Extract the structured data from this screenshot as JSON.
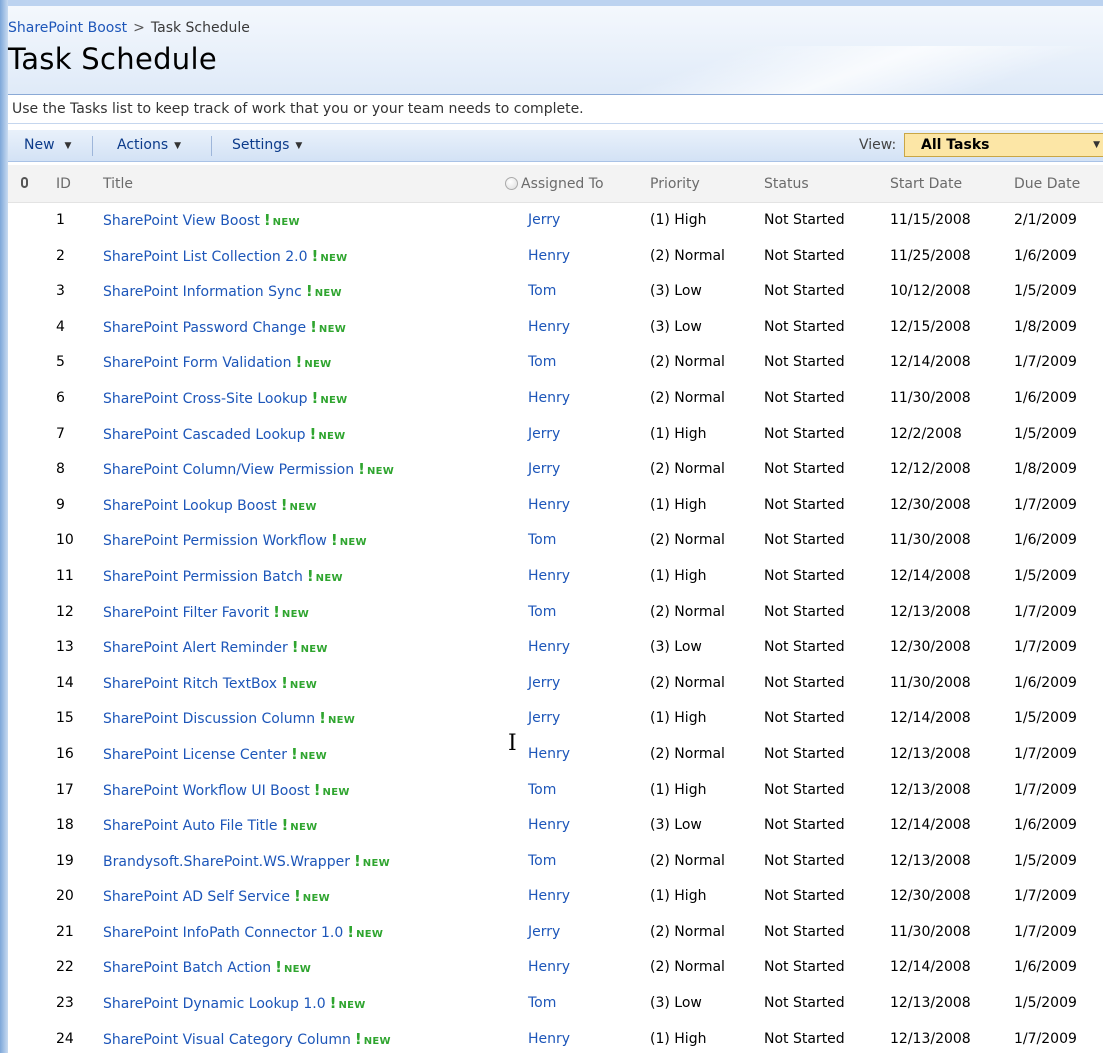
{
  "breadcrumb": {
    "site": "SharePoint Boost",
    "separator": ">",
    "current": "Task Schedule"
  },
  "page_title": "Task Schedule",
  "description": "Use the Tasks list to keep track of work that you or your team needs to complete.",
  "toolbar": {
    "new_label": "New",
    "actions_label": "Actions",
    "settings_label": "Settings",
    "view_label": "View:",
    "view_value": "All Tasks"
  },
  "columns": {
    "id": "ID",
    "title": "Title",
    "assigned_to": "Assigned To",
    "priority": "Priority",
    "status": "Status",
    "start_date": "Start Date",
    "due_date": "Due Date"
  },
  "new_badge": "NEW",
  "new_mark": "!",
  "rows": [
    {
      "id": "1",
      "title": "SharePoint View Boost",
      "assigned": "Jerry",
      "priority": "(1) High",
      "status": "Not Started",
      "start": "11/15/2008",
      "due": "2/1/2009"
    },
    {
      "id": "2",
      "title": "SharePoint List Collection 2.0",
      "assigned": "Henry",
      "priority": "(2) Normal",
      "status": "Not Started",
      "start": "11/25/2008",
      "due": "1/6/2009"
    },
    {
      "id": "3",
      "title": "SharePoint Information Sync",
      "assigned": "Tom",
      "priority": "(3) Low",
      "status": "Not Started",
      "start": "10/12/2008",
      "due": "1/5/2009"
    },
    {
      "id": "4",
      "title": "SharePoint Password Change",
      "assigned": "Henry",
      "priority": "(3) Low",
      "status": "Not Started",
      "start": "12/15/2008",
      "due": "1/8/2009"
    },
    {
      "id": "5",
      "title": "SharePoint Form Validation",
      "assigned": "Tom",
      "priority": "(2) Normal",
      "status": "Not Started",
      "start": "12/14/2008",
      "due": "1/7/2009"
    },
    {
      "id": "6",
      "title": "SharePoint Cross-Site Lookup",
      "assigned": "Henry",
      "priority": "(2) Normal",
      "status": "Not Started",
      "start": "11/30/2008",
      "due": "1/6/2009"
    },
    {
      "id": "7",
      "title": "SharePoint Cascaded Lookup",
      "assigned": "Jerry",
      "priority": "(1) High",
      "status": "Not Started",
      "start": "12/2/2008",
      "due": "1/5/2009"
    },
    {
      "id": "8",
      "title": "SharePoint Column/View Permission",
      "assigned": "Jerry",
      "priority": "(2) Normal",
      "status": "Not Started",
      "start": "12/12/2008",
      "due": "1/8/2009"
    },
    {
      "id": "9",
      "title": "SharePoint Lookup Boost",
      "assigned": "Henry",
      "priority": "(1) High",
      "status": "Not Started",
      "start": "12/30/2008",
      "due": "1/7/2009"
    },
    {
      "id": "10",
      "title": "SharePoint Permission Workflow",
      "assigned": "Tom",
      "priority": "(2) Normal",
      "status": "Not Started",
      "start": "11/30/2008",
      "due": "1/6/2009"
    },
    {
      "id": "11",
      "title": "SharePoint Permission Batch",
      "assigned": "Henry",
      "priority": "(1) High",
      "status": "Not Started",
      "start": "12/14/2008",
      "due": "1/5/2009"
    },
    {
      "id": "12",
      "title": "SharePoint Filter Favorit",
      "assigned": "Tom",
      "priority": "(2) Normal",
      "status": "Not Started",
      "start": "12/13/2008",
      "due": "1/7/2009"
    },
    {
      "id": "13",
      "title": "SharePoint Alert Reminder",
      "assigned": "Henry",
      "priority": "(3) Low",
      "status": "Not Started",
      "start": "12/30/2008",
      "due": "1/7/2009"
    },
    {
      "id": "14",
      "title": "SharePoint Ritch TextBox",
      "assigned": "Jerry",
      "priority": "(2) Normal",
      "status": "Not Started",
      "start": "11/30/2008",
      "due": "1/6/2009"
    },
    {
      "id": "15",
      "title": "SharePoint Discussion Column",
      "assigned": "Jerry",
      "priority": "(1) High",
      "status": "Not Started",
      "start": "12/14/2008",
      "due": "1/5/2009"
    },
    {
      "id": "16",
      "title": "SharePoint License Center",
      "assigned": "Henry",
      "priority": "(2) Normal",
      "status": "Not Started",
      "start": "12/13/2008",
      "due": "1/7/2009"
    },
    {
      "id": "17",
      "title": "SharePoint Workflow UI Boost",
      "assigned": "Tom",
      "priority": "(1) High",
      "status": "Not Started",
      "start": "12/13/2008",
      "due": "1/7/2009"
    },
    {
      "id": "18",
      "title": "SharePoint Auto File Title",
      "assigned": "Henry",
      "priority": "(3) Low",
      "status": "Not Started",
      "start": "12/14/2008",
      "due": "1/6/2009"
    },
    {
      "id": "19",
      "title": "Brandysoft.SharePoint.WS.Wrapper",
      "assigned": "Tom",
      "priority": "(2) Normal",
      "status": "Not Started",
      "start": "12/13/2008",
      "due": "1/5/2009"
    },
    {
      "id": "20",
      "title": "SharePoint AD Self Service",
      "assigned": "Henry",
      "priority": "(1) High",
      "status": "Not Started",
      "start": "12/30/2008",
      "due": "1/7/2009"
    },
    {
      "id": "21",
      "title": "SharePoint InfoPath Connector 1.0",
      "assigned": "Jerry",
      "priority": "(2) Normal",
      "status": "Not Started",
      "start": "11/30/2008",
      "due": "1/7/2009"
    },
    {
      "id": "22",
      "title": "SharePoint Batch Action",
      "assigned": "Henry",
      "priority": "(2) Normal",
      "status": "Not Started",
      "start": "12/14/2008",
      "due": "1/6/2009"
    },
    {
      "id": "23",
      "title": "SharePoint Dynamic Lookup 1.0",
      "assigned": "Tom",
      "priority": "(3) Low",
      "status": "Not Started",
      "start": "12/13/2008",
      "due": "1/5/2009"
    },
    {
      "id": "24",
      "title": "SharePoint Visual Category Column",
      "assigned": "Henry",
      "priority": "(1) High",
      "status": "Not Started",
      "start": "12/13/2008",
      "due": "1/7/2009"
    }
  ]
}
